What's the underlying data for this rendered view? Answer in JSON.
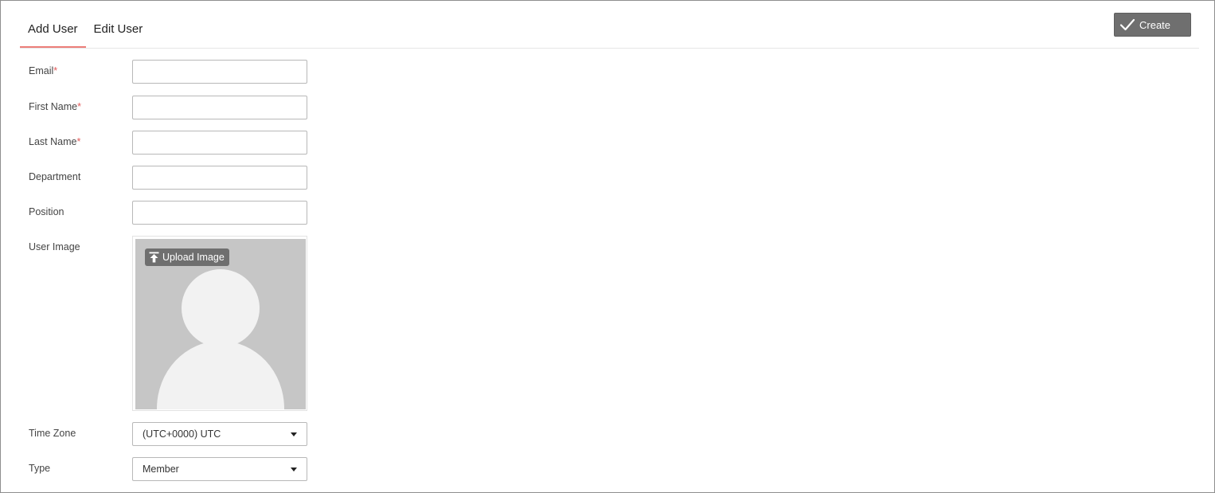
{
  "tabs": [
    {
      "label": "Add User",
      "active": true
    },
    {
      "label": "Edit User",
      "active": false
    }
  ],
  "toolbar": {
    "create_label": "Create",
    "create_icon": "check-icon"
  },
  "form": {
    "email": {
      "label": "Email",
      "required_mark": "*",
      "value": "",
      "placeholder": ""
    },
    "first_name": {
      "label": "First Name",
      "required_mark": "*",
      "value": "",
      "placeholder": ""
    },
    "last_name": {
      "label": "Last Name",
      "required_mark": "*",
      "value": "",
      "placeholder": ""
    },
    "department": {
      "label": "Department",
      "value": "",
      "placeholder": ""
    },
    "position": {
      "label": "Position",
      "value": "",
      "placeholder": ""
    },
    "user_image": {
      "label": "User Image",
      "upload_label": "Upload Image",
      "upload_icon": "upload-icon",
      "placeholder_icon": "avatar-placeholder-icon"
    },
    "time_zone": {
      "label": "Time Zone",
      "selected": "(UTC+0000) UTC"
    },
    "type": {
      "label": "Type",
      "selected": "Member"
    }
  },
  "colors": {
    "tab_active_underline": "#ec7e79",
    "required": "#e35b5b",
    "button_bg": "#6f6f6f",
    "image_bg": "#c6c6c6"
  }
}
